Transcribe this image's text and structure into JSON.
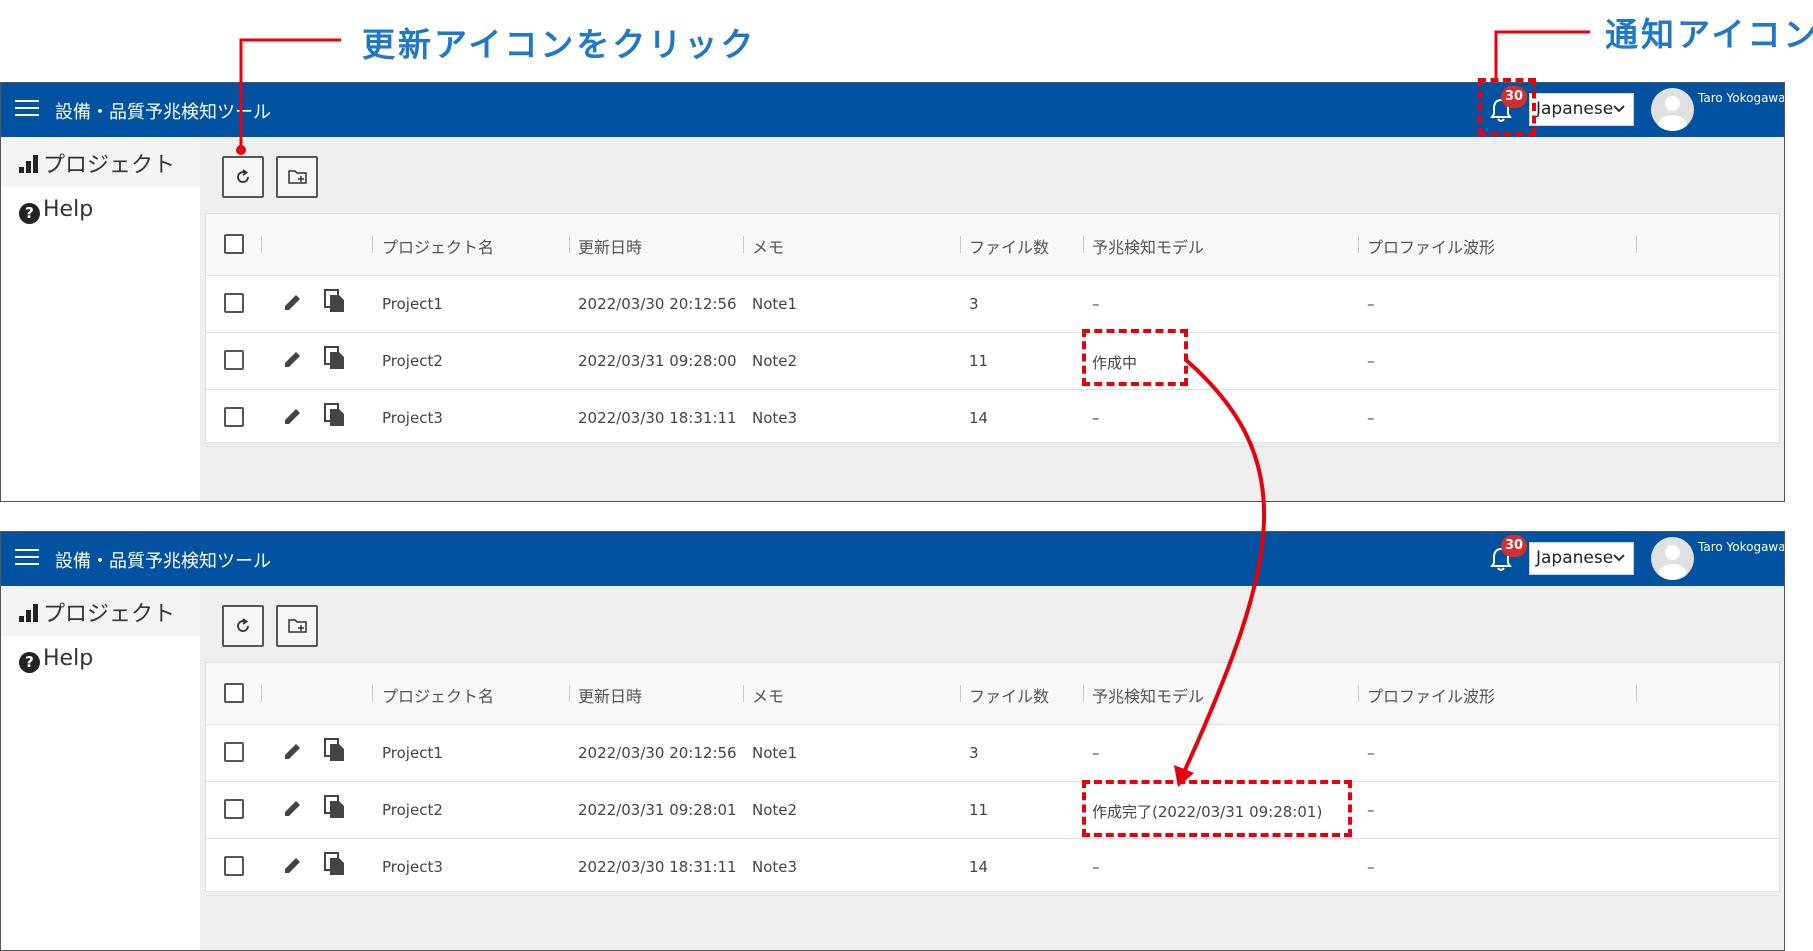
{
  "annotations": {
    "refresh_click": "更新アイコンをクリック",
    "notification_icon": "通知アイコン"
  },
  "colors": {
    "appbar": "#0153a2",
    "highlight": "#e8000b",
    "annotation": "#1f78c8",
    "badge": "#d32f2f"
  },
  "app": {
    "title": "設備・品質予兆検知ツール",
    "notification_count": "30",
    "language": "Japanese",
    "user": "Taro Yokogawa"
  },
  "sidebar": {
    "items": [
      {
        "label": "プロジェクト",
        "icon": "signal-bars-icon"
      },
      {
        "label": "Help",
        "icon": "help-icon"
      }
    ]
  },
  "toolbar": {
    "refresh_icon": "refresh-icon",
    "add_folder_icon": "create-folder-icon"
  },
  "table": {
    "columns": [
      "プロジェクト名",
      "更新日時",
      "メモ",
      "ファイル数",
      "予兆検知モデル",
      "プロファイル波形"
    ]
  },
  "screen_before": {
    "rows": [
      {
        "name": "Project1",
        "updated": "2022/03/30 20:12:56",
        "memo": "Note1",
        "files": "3",
        "model": "–",
        "profile": "–"
      },
      {
        "name": "Project2",
        "updated": "2022/03/31 09:28:00",
        "memo": "Note2",
        "files": "11",
        "model": "作成中",
        "profile": "–"
      },
      {
        "name": "Project3",
        "updated": "2022/03/30 18:31:11",
        "memo": "Note3",
        "files": "14",
        "model": "–",
        "profile": "–"
      }
    ]
  },
  "screen_after": {
    "rows": [
      {
        "name": "Project1",
        "updated": "2022/03/30 20:12:56",
        "memo": "Note1",
        "files": "3",
        "model": "–",
        "profile": "–"
      },
      {
        "name": "Project2",
        "updated": "2022/03/31 09:28:01",
        "memo": "Note2",
        "files": "11",
        "model": "作成完了(2022/03/31 09:28:01)",
        "profile": "–"
      },
      {
        "name": "Project3",
        "updated": "2022/03/30 18:31:11",
        "memo": "Note3",
        "files": "14",
        "model": "–",
        "profile": "–"
      }
    ]
  }
}
